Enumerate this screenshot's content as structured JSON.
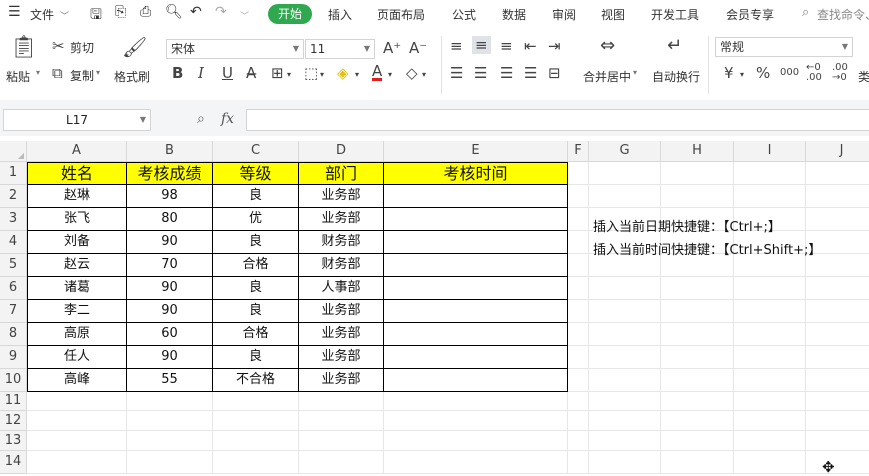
{
  "menubar": {
    "file_label": "文件",
    "tabs": [
      "开始",
      "插入",
      "页面布局",
      "公式",
      "数据",
      "审阅",
      "视图",
      "开发工具",
      "会员专享"
    ],
    "search_placeholder": "查找命令、"
  },
  "ribbon": {
    "paste": "粘贴",
    "cut": "剪切",
    "copy": "复制",
    "format_painter": "格式刷",
    "font_name": "宋体",
    "font_size": "11",
    "merge_center": "合并居中",
    "wrap_text": "自动换行",
    "number_format": "常规",
    "currency_symbol": "¥",
    "percent_symbol": "%",
    "thousands": "000",
    "type_label": "类"
  },
  "formula_bar": {
    "cell_ref": "L17",
    "fx": "fx",
    "value": ""
  },
  "sheet": {
    "columns": [
      "A",
      "B",
      "C",
      "D",
      "E",
      "F",
      "G",
      "H",
      "I",
      "J"
    ],
    "rows": [
      "1",
      "2",
      "3",
      "4",
      "5",
      "6",
      "7",
      "8",
      "9",
      "10",
      "11",
      "12",
      "13",
      "14"
    ],
    "headers": [
      "姓名",
      "考核成绩",
      "等级",
      "部门",
      "考核时间"
    ],
    "data": [
      [
        "赵琳",
        "98",
        "良",
        "业务部",
        ""
      ],
      [
        "张飞",
        "80",
        "优",
        "业务部",
        ""
      ],
      [
        "刘备",
        "90",
        "良",
        "财务部",
        ""
      ],
      [
        "赵云",
        "70",
        "合格",
        "财务部",
        ""
      ],
      [
        "诸葛",
        "90",
        "良",
        "人事部",
        ""
      ],
      [
        "李二",
        "90",
        "良",
        "业务部",
        ""
      ],
      [
        "高原",
        "60",
        "合格",
        "业务部",
        ""
      ],
      [
        "任人",
        "90",
        "良",
        "业务部",
        ""
      ],
      [
        "高峰",
        "55",
        "不合格",
        "业务部",
        ""
      ]
    ],
    "notes": [
      "插入当前日期快捷键：【Ctrl+;】",
      "插入当前时间快捷键：【Ctrl+Shift+;】"
    ]
  },
  "colors": {
    "accent": "#2fa84f",
    "header_fill": "#ffff00"
  }
}
